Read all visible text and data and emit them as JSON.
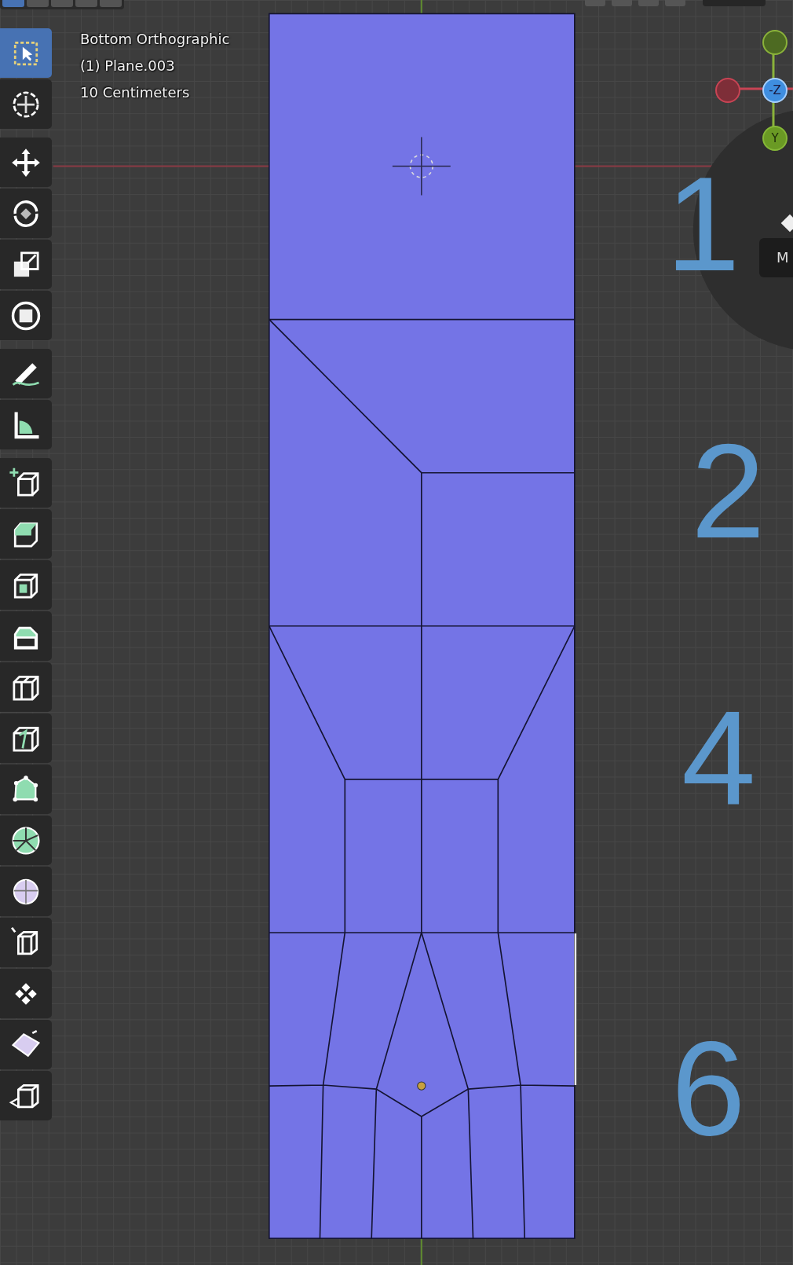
{
  "header_modes": [
    {
      "selected": true
    },
    {
      "selected": false
    },
    {
      "selected": false
    },
    {
      "selected": false
    },
    {
      "selected": false
    }
  ],
  "overlay_text": [
    "Bottom Orthographic",
    "(1) Plane.003",
    "10 Centimeters"
  ],
  "toolbar": [
    {
      "tools": [
        {
          "kind": "select",
          "selected": true
        },
        {
          "kind": "cursor",
          "selected": false
        }
      ]
    },
    {
      "tools": [
        {
          "kind": "move",
          "selected": false
        },
        {
          "kind": "rotate",
          "selected": false
        },
        {
          "kind": "scale",
          "selected": false
        },
        {
          "kind": "transform",
          "selected": false
        }
      ]
    },
    {
      "tools": [
        {
          "kind": "annotate",
          "selected": false
        },
        {
          "kind": "measure",
          "selected": false
        }
      ]
    },
    {
      "tools": [
        {
          "kind": "add-cube",
          "selected": false
        },
        {
          "kind": "extrude",
          "selected": false
        },
        {
          "kind": "inset",
          "selected": false
        },
        {
          "kind": "bevel",
          "selected": false
        },
        {
          "kind": "loop-cut",
          "selected": false
        },
        {
          "kind": "knife",
          "selected": false
        },
        {
          "kind": "poly-build",
          "selected": false
        },
        {
          "kind": "spin",
          "selected": false
        },
        {
          "kind": "smooth",
          "selected": false
        },
        {
          "kind": "edge-slide",
          "selected": false
        },
        {
          "kind": "shrink",
          "selected": false
        },
        {
          "kind": "shear",
          "selected": false
        },
        {
          "kind": "rip",
          "selected": false
        }
      ]
    }
  ],
  "gizmo": {
    "z_label": "-Z",
    "y_label": "Y"
  },
  "tooltip": {
    "text": "M"
  },
  "annotations": [
    {
      "text": "1"
    },
    {
      "text": "2"
    },
    {
      "text": "4"
    },
    {
      "text": "6"
    }
  ]
}
